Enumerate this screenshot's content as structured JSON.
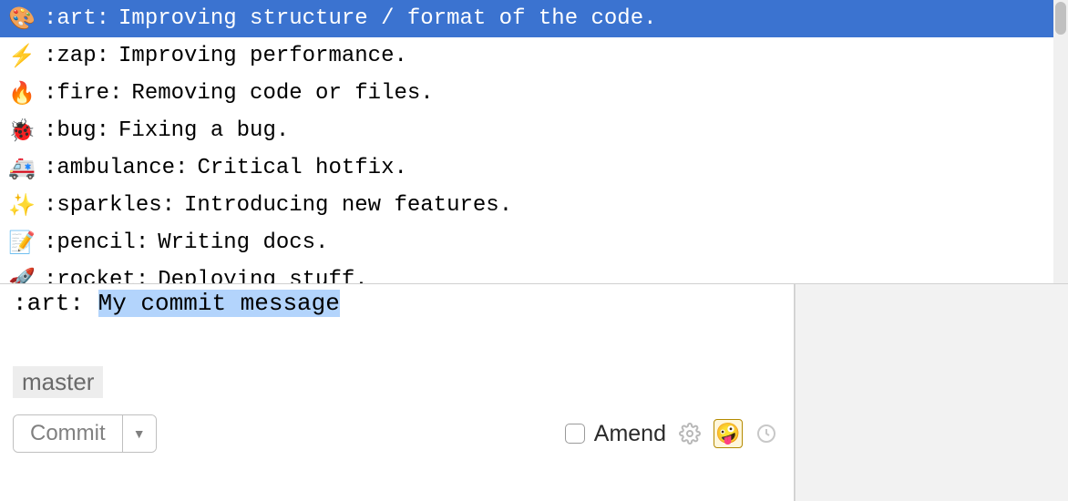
{
  "autocomplete": {
    "selected_index": 0,
    "items": [
      {
        "emoji": "🎨",
        "code": ":art:",
        "desc": "Improving structure / format of the code."
      },
      {
        "emoji": "⚡",
        "code": ":zap:",
        "desc": "Improving performance."
      },
      {
        "emoji": "🔥",
        "code": ":fire:",
        "desc": "Removing code or files."
      },
      {
        "emoji": "🐞",
        "code": ":bug:",
        "desc": "Fixing a bug."
      },
      {
        "emoji": "🚑",
        "code": ":ambulance:",
        "desc": "Critical hotfix."
      },
      {
        "emoji": "✨",
        "code": ":sparkles:",
        "desc": "Introducing new features."
      },
      {
        "emoji": "📝",
        "code": ":pencil:",
        "desc": "Writing docs."
      },
      {
        "emoji": "🚀",
        "code": ":rocket:",
        "desc": "Deploying stuff."
      }
    ]
  },
  "commit_message": {
    "prefix": ":art: ",
    "selected_text": "My commit message"
  },
  "branch": {
    "name": "master"
  },
  "toolbar": {
    "commit_label": "Commit",
    "amend_label": "Amend",
    "amend_checked": false,
    "emoji_button_glyph": "🤪"
  }
}
